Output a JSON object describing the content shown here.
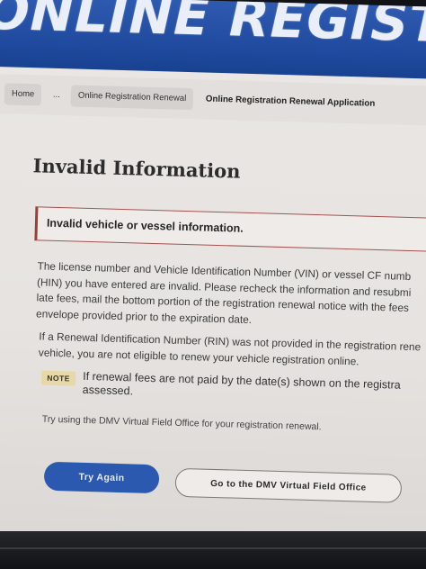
{
  "banner": {
    "title": "ONLINE REGISTRATIO"
  },
  "breadcrumb": {
    "home": "Home",
    "ellipsis": "...",
    "parent": "Online Registration Renewal",
    "current": "Online Registration Renewal Application"
  },
  "main": {
    "heading": "Invalid Information",
    "alert": "Invalid vehicle or vessel information.",
    "paragraph1_lines": [
      "The license number and Vehicle Identification Number (VIN) or vessel CF numb",
      "(HIN) you have entered are invalid. Please recheck the information and resubmi",
      "late fees, mail the bottom portion of the registration renewal notice with the fees",
      "envelope provided prior to the expiration date."
    ],
    "paragraph2_lines": [
      "If a Renewal Identification Number (RIN) was not provided in the registration rene",
      "vehicle, you are not eligible to renew your vehicle registration online."
    ],
    "note": {
      "badge": "NOTE",
      "lines": [
        "If renewal fees are not paid by the date(s) shown on the registra",
        "assessed."
      ]
    },
    "tip": "Try using the DMV Virtual Field Office for your registration renewal."
  },
  "buttons": {
    "try_again": "Try Again",
    "virtual_office": "Go to the DMV Virtual Field Office"
  },
  "colors": {
    "banner_blue": "#1f4a9e",
    "primary_button": "#2c59b0",
    "alert_border": "#a4524f",
    "note_badge": "#e7d8a8"
  }
}
